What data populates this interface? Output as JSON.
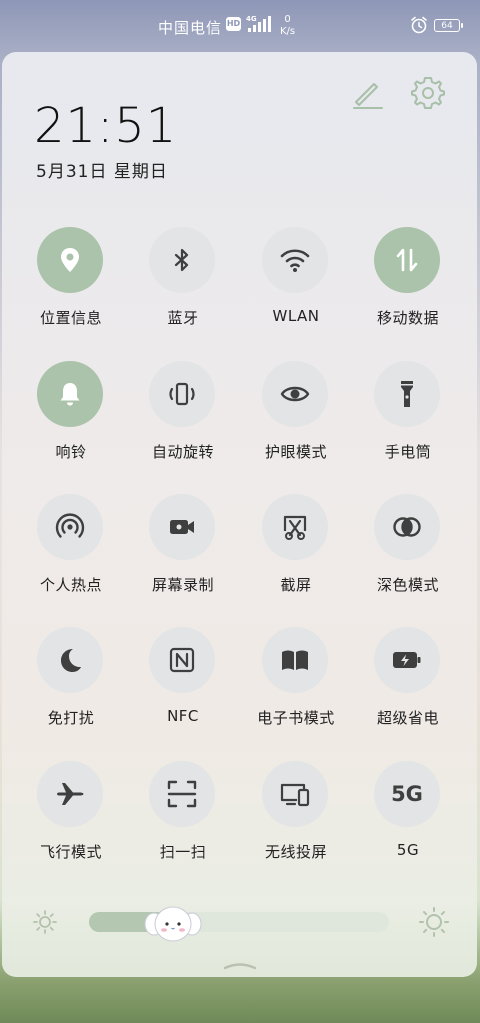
{
  "status_bar": {
    "carrier": "中国电信",
    "hd_badge": "HD",
    "network_type": "4G",
    "speed_value": "0",
    "speed_unit": "K/s",
    "battery_level": "64"
  },
  "clock": {
    "time": "21:51",
    "date": "5月31日 星期日"
  },
  "toggles": [
    {
      "label": "位置信息",
      "icon": "location-icon",
      "active": true
    },
    {
      "label": "蓝牙",
      "icon": "bluetooth-icon",
      "active": false
    },
    {
      "label": "WLAN",
      "icon": "wifi-icon",
      "active": false
    },
    {
      "label": "移动数据",
      "icon": "mobile-data-icon",
      "active": true
    },
    {
      "label": "响铃",
      "icon": "bell-icon",
      "active": true
    },
    {
      "label": "自动旋转",
      "icon": "rotate-icon",
      "active": false
    },
    {
      "label": "护眼模式",
      "icon": "eye-icon",
      "active": false
    },
    {
      "label": "手电筒",
      "icon": "flashlight-icon",
      "active": false
    },
    {
      "label": "个人热点",
      "icon": "hotspot-icon",
      "active": false
    },
    {
      "label": "屏幕录制",
      "icon": "screen-record-icon",
      "active": false
    },
    {
      "label": "截屏",
      "icon": "screenshot-icon",
      "active": false
    },
    {
      "label": "深色模式",
      "icon": "dark-mode-icon",
      "active": false
    },
    {
      "label": "免打扰",
      "icon": "moon-icon",
      "active": false
    },
    {
      "label": "NFC",
      "icon": "nfc-icon",
      "active": false
    },
    {
      "label": "电子书模式",
      "icon": "book-icon",
      "active": false
    },
    {
      "label": "超级省电",
      "icon": "battery-saver-icon",
      "active": false
    },
    {
      "label": "飞行模式",
      "icon": "airplane-icon",
      "active": false
    },
    {
      "label": "扫一扫",
      "icon": "scan-icon",
      "active": false
    },
    {
      "label": "无线投屏",
      "icon": "cast-icon",
      "active": false
    },
    {
      "label": "5G",
      "icon": "5g-icon",
      "icon_text": "5G",
      "active": false
    }
  ],
  "brightness": {
    "level": 0.28
  },
  "colors": {
    "active": "#aac3aa",
    "inactive": "#e2e4e6",
    "icon": "#3f3f3f",
    "icon_on": "#ffffff"
  }
}
